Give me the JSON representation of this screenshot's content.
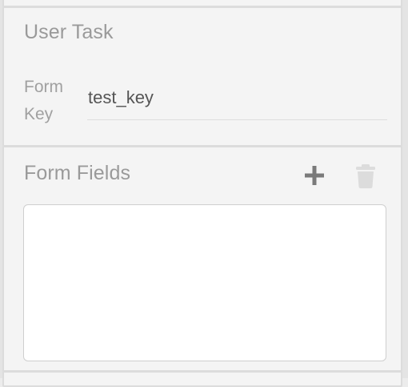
{
  "user_task": {
    "title": "User Task",
    "form_key_label": "Form Key",
    "form_key_value": "test_key"
  },
  "form_fields": {
    "title": "Form Fields",
    "add_icon": "plus-icon",
    "delete_icon": "trash-icon"
  },
  "colors": {
    "panel_bg": "#f4f4f4",
    "title_text": "#9a9a9a",
    "value_text": "#555555",
    "add_icon": "#7a7a7a",
    "trash_icon": "#dcdcdc"
  }
}
